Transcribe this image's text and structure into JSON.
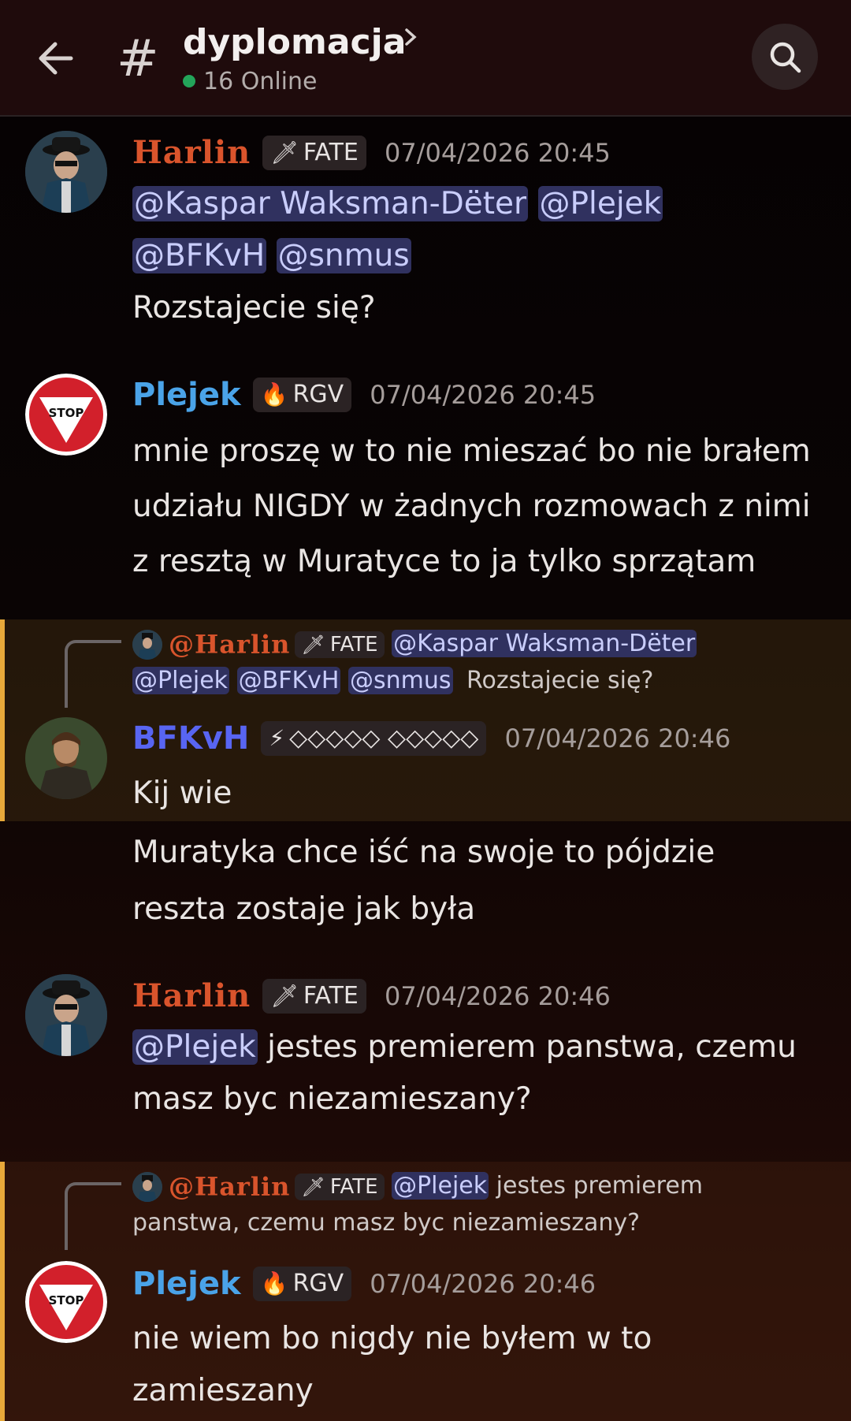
{
  "header": {
    "channel": "dyplomacja",
    "online": "16 Online"
  },
  "messages": [
    {
      "author": "Harlin",
      "tag": "FATE",
      "time": "07/04/2026 20:45",
      "mentions": [
        "@Kaspar Waksman-Dëter",
        "@Plejek",
        "@BFKvH",
        "@snmus"
      ],
      "text": "Rozstajecie się?"
    },
    {
      "author": "Plejek",
      "tag": "RGV",
      "time": "07/04/2026 20:45",
      "lines": [
        "mnie proszę w to nie mieszać bo nie brałem",
        "udziału NIGDY w żadnych rozmowach z nimi",
        "z resztą w Muratyce to ja tylko sprzątam"
      ]
    },
    {
      "reply": {
        "author": "@Harlin",
        "tag": "FATE",
        "mentions": [
          "@Kaspar Waksman-Dëter",
          "@Plejek",
          "@BFKvH",
          "@snmus"
        ],
        "text": "Rozstajecie się?"
      },
      "author": "BFKvH",
      "tag": "◇◇◇◇◇ ◇◇◇◇◇",
      "time": "07/04/2026 20:46",
      "text": "Kij wie",
      "followups": [
        "Muratyka chce iść na swoje to pójdzie",
        "reszta zostaje jak była"
      ]
    },
    {
      "author": "Harlin",
      "tag": "FATE",
      "time": "07/04/2026 20:46",
      "mention": "@Plejek",
      "text1": " jestes premierem panstwa, czemu",
      "text2": "masz byc niezamieszany?"
    },
    {
      "reply": {
        "author": "@Harlin",
        "tag": "FATE",
        "mention": "@Plejek",
        "text1": " jestes premierem",
        "text2": "panstwa, czemu masz byc niezamieszany?"
      },
      "author": "Plejek",
      "tag": "RGV",
      "time": "07/04/2026 20:46",
      "lines": [
        "nie wiem bo nigdy nie byłem w to",
        "zamieszany"
      ]
    }
  ],
  "icons": {
    "back": "arrow-left-icon",
    "hash": "hash-icon",
    "search": "search-icon",
    "sword": "sword-icon",
    "fire": "fire-icon",
    "lightning": "lightning-icon"
  },
  "colors": {
    "harlin": "#d9542c",
    "plejek": "#4aa3e8",
    "bfkvh": "#5865f2",
    "mention_bg": "#30315f",
    "highlight_border": "#e8a93a",
    "online": "#23a55a"
  }
}
